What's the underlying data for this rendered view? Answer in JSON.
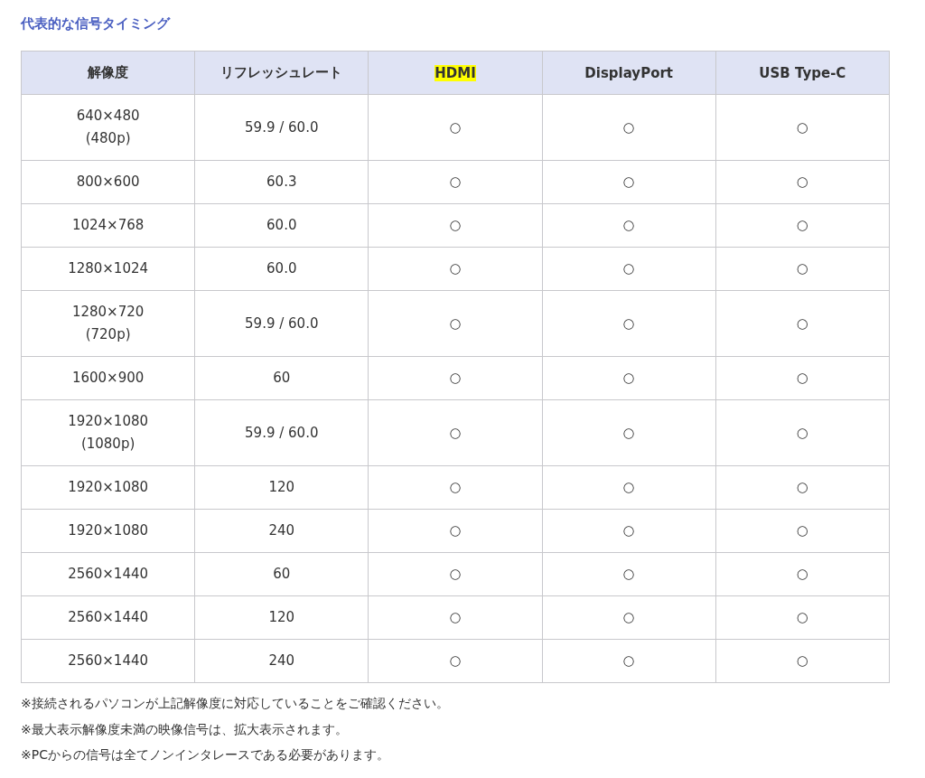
{
  "title": "代表的な信号タイミング",
  "table": {
    "columns": [
      {
        "label": "解像度",
        "highlighted": false
      },
      {
        "label": "リフレッシュレート",
        "highlighted": false
      },
      {
        "label": "HDMI",
        "highlighted": true
      },
      {
        "label": "DisplayPort",
        "highlighted": false
      },
      {
        "label": "USB Type-C",
        "highlighted": false
      }
    ],
    "rows": [
      {
        "cells": [
          "640×480\n(480p)",
          "59.9 / 60.0",
          "○",
          "○",
          "○"
        ]
      },
      {
        "cells": [
          "800×600",
          "60.3",
          "○",
          "○",
          "○"
        ]
      },
      {
        "cells": [
          "1024×768",
          "60.0",
          "○",
          "○",
          "○"
        ]
      },
      {
        "cells": [
          "1280×1024",
          "60.0",
          "○",
          "○",
          "○"
        ]
      },
      {
        "cells": [
          "1280×720\n(720p)",
          "59.9 / 60.0",
          "○",
          "○",
          "○"
        ]
      },
      {
        "cells": [
          "1600×900",
          "60",
          "○",
          "○",
          "○"
        ]
      },
      {
        "cells": [
          "1920×1080\n(1080p)",
          "59.9 / 60.0",
          "○",
          "○",
          "○"
        ]
      },
      {
        "cells": [
          "1920×1080",
          "120",
          "○",
          "○",
          "○"
        ]
      },
      {
        "cells": [
          "1920×1080",
          "240",
          "○",
          "○",
          "○"
        ]
      },
      {
        "cells": [
          "2560×1440",
          "60",
          "○",
          "○",
          "○"
        ]
      },
      {
        "cells": [
          "2560×1440",
          "120",
          "○",
          "○",
          "○"
        ]
      },
      {
        "cells": [
          "2560×1440",
          "240",
          "○",
          "○",
          "○"
        ]
      }
    ]
  },
  "notes": [
    "※接続されるパソコンが上記解像度に対応していることをご確認ください。",
    "※最大表示解像度未満の映像信号は、拡大表示されます。",
    "※PCからの信号は全てノンインタレースである必要があります。"
  ]
}
